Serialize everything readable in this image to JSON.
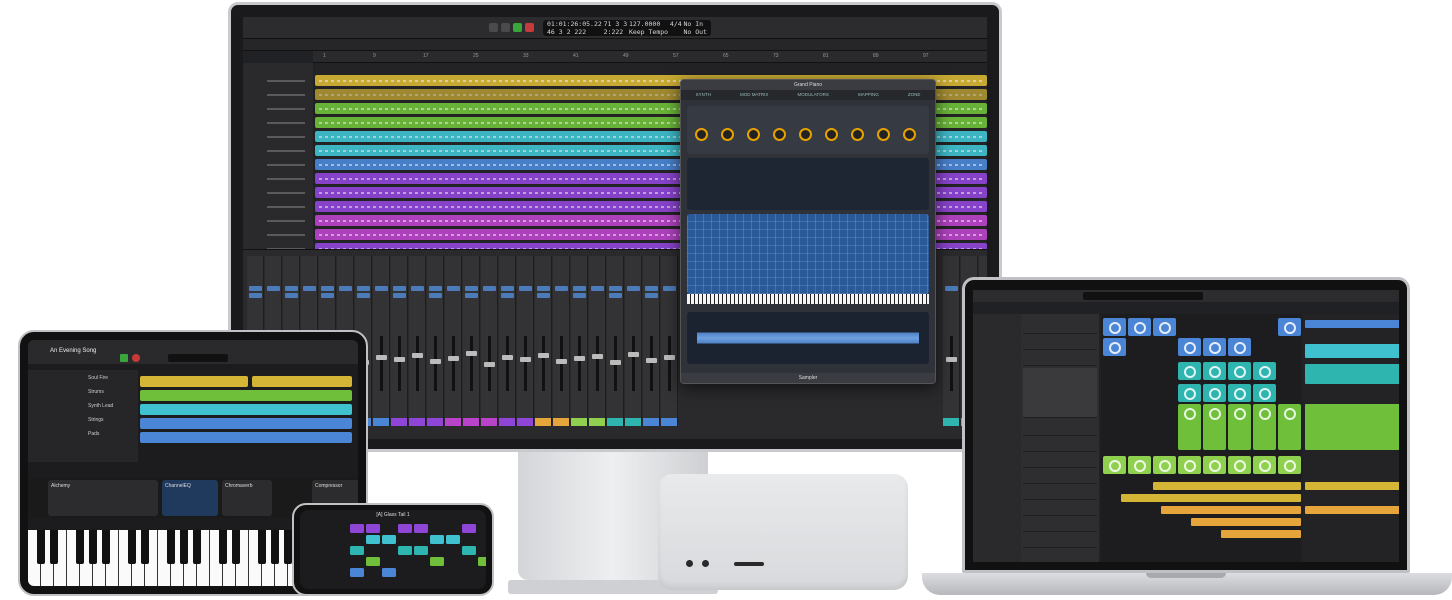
{
  "monitor": {
    "lcd": {
      "position_top": "01:01:26:05.22",
      "position_bottom": "46  3  2  222",
      "bar_top": "71  3  3",
      "bar_bottom": "2:222",
      "tempo": "127.0000",
      "tempo_label": "Keep Tempo",
      "signature": "4/4",
      "key": "No In",
      "key2": "No Out"
    },
    "plugin": {
      "title": "Grand Piano",
      "tabs": [
        "SYNTH",
        "MOD MATRIX",
        "MODULATORS",
        "MAPPING",
        "ZONE"
      ],
      "footer": "Sampler"
    }
  },
  "ipad": {
    "song_title": "An Evening Song",
    "tracks": [
      "Soul Fire",
      "Strums",
      "Synth Lead",
      "Strings",
      "Pads"
    ],
    "plugins": [
      "Alchemy",
      "ChannelEQ",
      "Chromaverb",
      "Compressor"
    ]
  },
  "iphone": {
    "title": "[A] Glass Tail 1"
  },
  "colors": {
    "yellow": "#d4b535",
    "green": "#6fbf3a",
    "cyan": "#3fc1d0",
    "blue": "#4b86d6",
    "purple": "#8f45d6",
    "magenta": "#b944c9",
    "orange": "#e6a53a",
    "lime": "#8fd14f",
    "teal": "#2fb5b0"
  }
}
